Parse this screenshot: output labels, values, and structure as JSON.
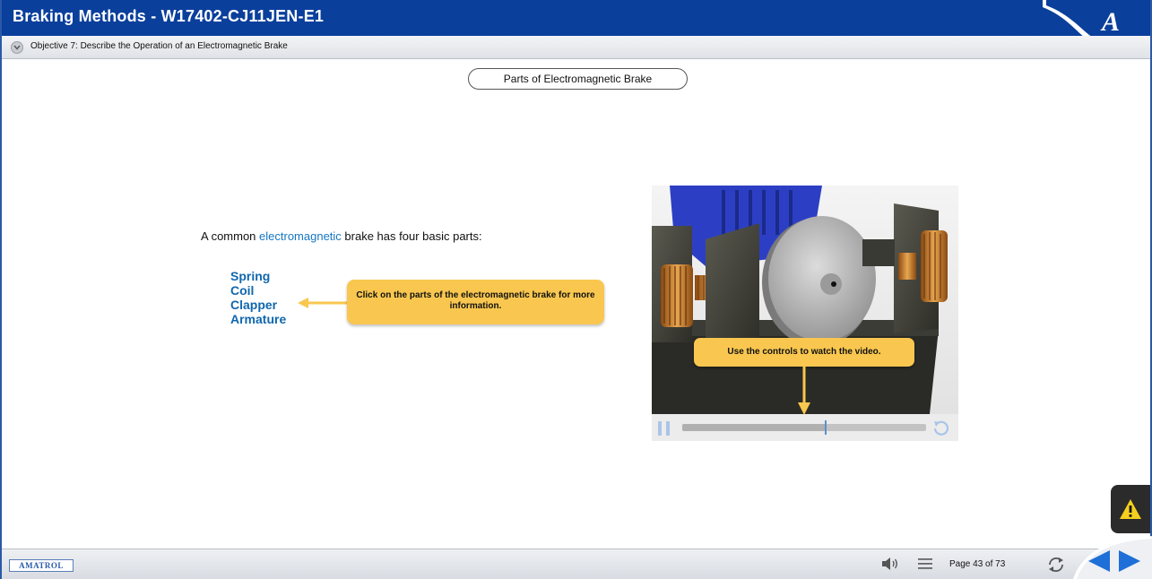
{
  "header": {
    "title": "Braking Methods - W17402-CJ11JEN-E1",
    "logo_letter": "A"
  },
  "objective": {
    "text": "Objective 7: Describe the Operation of an Electromagnetic Brake"
  },
  "content": {
    "section_title": "Parts of Electromagnetic Brake",
    "intro_before": "A common ",
    "intro_keyword": "electromagnetic",
    "intro_after": " brake has four basic parts:",
    "parts": [
      "Spring",
      "Coil",
      "Clapper",
      "Armature"
    ],
    "parts_callout": "Click on the parts of the electromagnetic brake for more information."
  },
  "video": {
    "callout": "Use the controls to watch the video.",
    "progress": 0.59
  },
  "footer": {
    "brand": "AMATROL",
    "page_label": "Page 43 of 73"
  },
  "colors": {
    "title_bar": "#0a3f9c",
    "accent_blue": "#1167ad",
    "callout_yellow": "#f9c74f",
    "nav_arrow": "#1f6fd8"
  },
  "icons": {
    "objective_toggle": "chevron-down-icon",
    "warning": "warning-icon",
    "volume": "speaker-icon",
    "menu": "menu-icon",
    "reload": "reload-icon",
    "prev": "arrow-left-icon",
    "next": "arrow-right-icon",
    "pause": "pause-icon",
    "replay": "replay-icon"
  }
}
